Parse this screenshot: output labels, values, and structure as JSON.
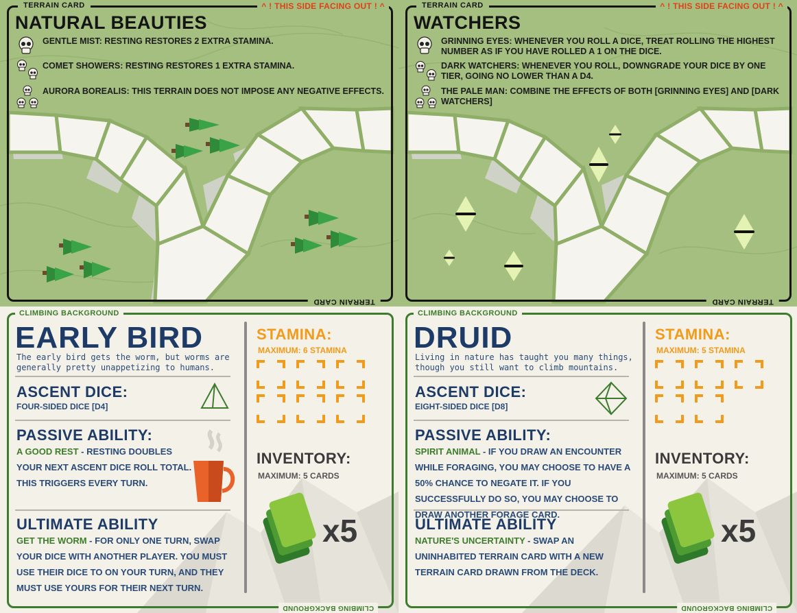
{
  "terrain_cards": [
    {
      "tab_label": "TERRAIN CARD",
      "facing_label": "! THIS SIDE FACING OUT !",
      "bottom_label": "TERRAIN CARD",
      "title": "NATURAL BEAUTIES",
      "rules": [
        {
          "skulls": 1,
          "name": "GENTLE MIST",
          "text": "RESTING RESTORES 2 EXTRA STAMINA."
        },
        {
          "skulls": 2,
          "name": "COMET SHOWERS",
          "text": "RESTING RESTORES 1 EXTRA STAMINA."
        },
        {
          "skulls": 3,
          "name": "AURORA BOREALIS",
          "text": "THIS TERRAIN DOES NOT IMPOSE ANY NEGATIVE EFFECTS."
        }
      ],
      "decoration": "pine-tree-icon"
    },
    {
      "tab_label": "TERRAIN CARD",
      "facing_label": "! THIS SIDE FACING OUT !",
      "bottom_label": "TERRAIN CARD",
      "title": "WATCHERS",
      "rules": [
        {
          "skulls": 1,
          "name": "GRINNING EYES",
          "text": "WHENEVER YOU ROLL A DICE, TREAT ROLLING THE HIGHEST NUMBER AS IF YOU HAVE ROLLED A 1 ON THE DICE."
        },
        {
          "skulls": 2,
          "name": "DARK WATCHERS",
          "text": "WHENEVER YOU ROLL, DOWNGRADE YOUR DICE BY ONE TIER, GOING NO LOWER THAN A D4."
        },
        {
          "skulls": 3,
          "name": "THE PALE MAN",
          "text": "COMBINE THE EFFECTS OF BOTH [GRINNING EYES] AND [DARK WATCHERS]"
        }
      ],
      "decoration": "watcher-eye-icon"
    }
  ],
  "climbing_cards": [
    {
      "tab_label": "CLIMBING BACKGROUND",
      "bottom_label": "CLIMBING BACKGROUND",
      "name": "EARLY BIRD",
      "flavor": "The early bird gets the worm, but worms are generally pretty unappetizing to humans.",
      "ascent_heading": "ASCENT DICE:",
      "ascent_value": "FOUR-SIDED DICE [D4]",
      "dice_icon": "d4-icon",
      "passive_heading": "PASSIVE ABILITY:",
      "passive_name": "A GOOD REST",
      "passive_text": " - RESTING DOUBLES YOUR NEXT ASCENT DICE ROLL TOTAL. THIS TRIGGERS EVERY TURN.",
      "ultimate_heading": "ULTIMATE ABILITY",
      "ultimate_name": "GET THE WORM",
      "ultimate_text": " - FOR ONLY ONE TURN, SWAP YOUR DICE WITH ANOTHER PLAYER. YOU MUST USE THEIR DICE TO ON YOUR TURN, AND THEY MUST USE YOURS FOR THEIR NEXT TURN.",
      "stamina_heading": "STAMINA:",
      "stamina_max": "MAXIMUM: 6 STAMINA",
      "stamina_slots": 6,
      "inventory_heading": "INVENTORY:",
      "inventory_max": "MAXIMUM: 5 CARDS",
      "card_count": "x5",
      "illustration": "coffee-mug-icon"
    },
    {
      "tab_label": "CLIMBING BACKGROUND",
      "bottom_label": "CLIMBING BACKGROUND",
      "name": "DRUID",
      "flavor": "Living in nature has taught you many things, though you still want to climb mountains.",
      "ascent_heading": "ASCENT DICE:",
      "ascent_value": "EIGHT-SIDED DICE [D8]",
      "dice_icon": "d8-icon",
      "passive_heading": "PASSIVE ABILITY:",
      "passive_name": "SPIRIT ANIMAL",
      "passive_text": " - IF YOU DRAW AN ENCOUNTER WHILE FORAGING, YOU MAY CHOOSE TO HAVE A 50% CHANCE TO NEGATE IT. IF YOU SUCCESSFULLY DO SO, YOU MAY CHOOSE TO DRAW ANOTHER FORAGE CARD.",
      "ultimate_heading": "ULTIMATE ABILITY",
      "ultimate_name": "NATURE'S UNCERTAINTY",
      "ultimate_text": " - SWAP AN UNINHABITED TERRAIN CARD WITH A NEW TERRAIN CARD DRAWN FROM THE DECK.",
      "stamina_heading": "STAMINA:",
      "stamina_max": "MAXIMUM: 5 STAMINA",
      "stamina_slots": 5,
      "inventory_heading": "INVENTORY:",
      "inventory_max": "MAXIMUM: 5 CARDS",
      "card_count": "x5",
      "illustration": "none"
    }
  ],
  "colors": {
    "terrain_bg": "#a4bf7f",
    "path": "#f6f4ee",
    "climb_bg": "#f4f1e8",
    "navy": "#1d3b66",
    "green": "#3d7c2c",
    "orange": "#f29a1a",
    "warning_red": "#e04018"
  }
}
